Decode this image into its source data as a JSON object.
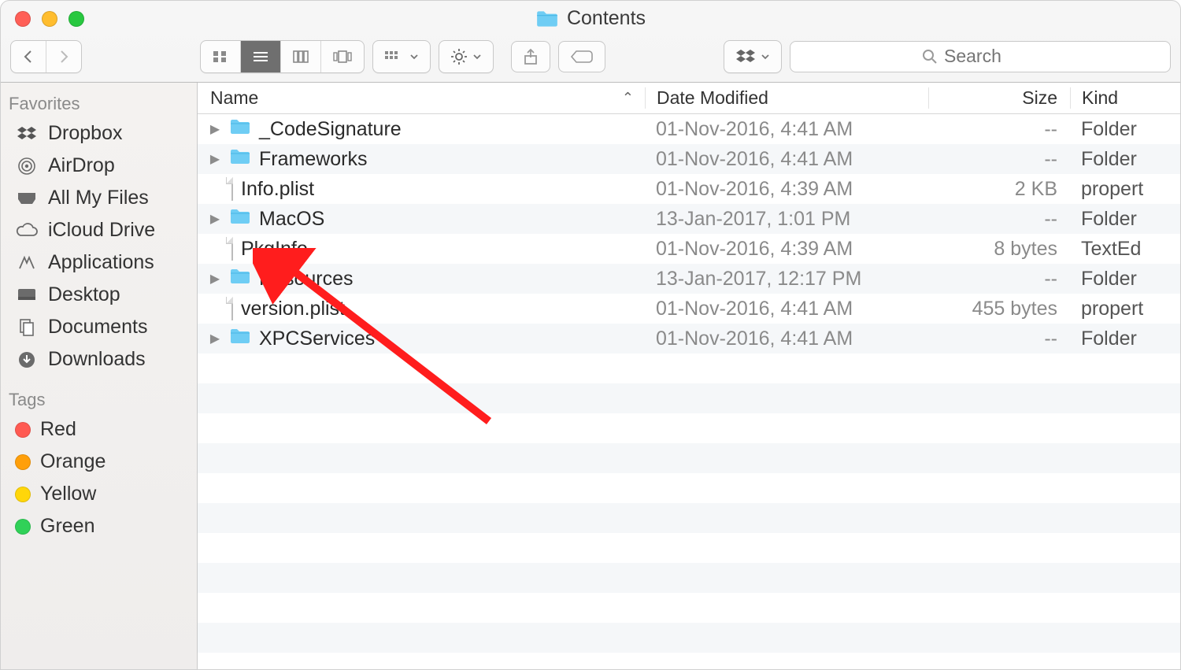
{
  "window": {
    "title": "Contents"
  },
  "search": {
    "placeholder": "Search"
  },
  "sidebar": {
    "section_favorites": "Favorites",
    "section_tags": "Tags",
    "items": [
      {
        "label": "Dropbox"
      },
      {
        "label": "AirDrop"
      },
      {
        "label": "All My Files"
      },
      {
        "label": "iCloud Drive"
      },
      {
        "label": "Applications"
      },
      {
        "label": "Desktop"
      },
      {
        "label": "Documents"
      },
      {
        "label": "Downloads"
      }
    ],
    "tags": [
      {
        "label": "Red",
        "color": "#ff5a52"
      },
      {
        "label": "Orange",
        "color": "#ff9f0a"
      },
      {
        "label": "Yellow",
        "color": "#ffd60a"
      },
      {
        "label": "Green",
        "color": "#30d158"
      }
    ]
  },
  "columns": {
    "name": "Name",
    "date": "Date Modified",
    "size": "Size",
    "kind": "Kind"
  },
  "files": [
    {
      "name": "_CodeSignature",
      "type": "folder",
      "date": "01-Nov-2016, 4:41 AM",
      "size": "--",
      "kind": "Folder"
    },
    {
      "name": "Frameworks",
      "type": "folder",
      "date": "01-Nov-2016, 4:41 AM",
      "size": "--",
      "kind": "Folder"
    },
    {
      "name": "Info.plist",
      "type": "file",
      "date": "01-Nov-2016, 4:39 AM",
      "size": "2 KB",
      "kind": "propert"
    },
    {
      "name": "MacOS",
      "type": "folder",
      "date": "13-Jan-2017, 1:01 PM",
      "size": "--",
      "kind": "Folder"
    },
    {
      "name": "PkgInfo",
      "type": "file",
      "date": "01-Nov-2016, 4:39 AM",
      "size": "8 bytes",
      "kind": "TextEd"
    },
    {
      "name": "Resources",
      "type": "folder",
      "date": "13-Jan-2017, 12:17 PM",
      "size": "--",
      "kind": "Folder"
    },
    {
      "name": "version.plist",
      "type": "file",
      "date": "01-Nov-2016, 4:41 AM",
      "size": "455 bytes",
      "kind": "propert"
    },
    {
      "name": "XPCServices",
      "type": "folder",
      "date": "01-Nov-2016, 4:41 AM",
      "size": "--",
      "kind": "Folder"
    }
  ],
  "annotation": {
    "points_to": "Resources"
  }
}
